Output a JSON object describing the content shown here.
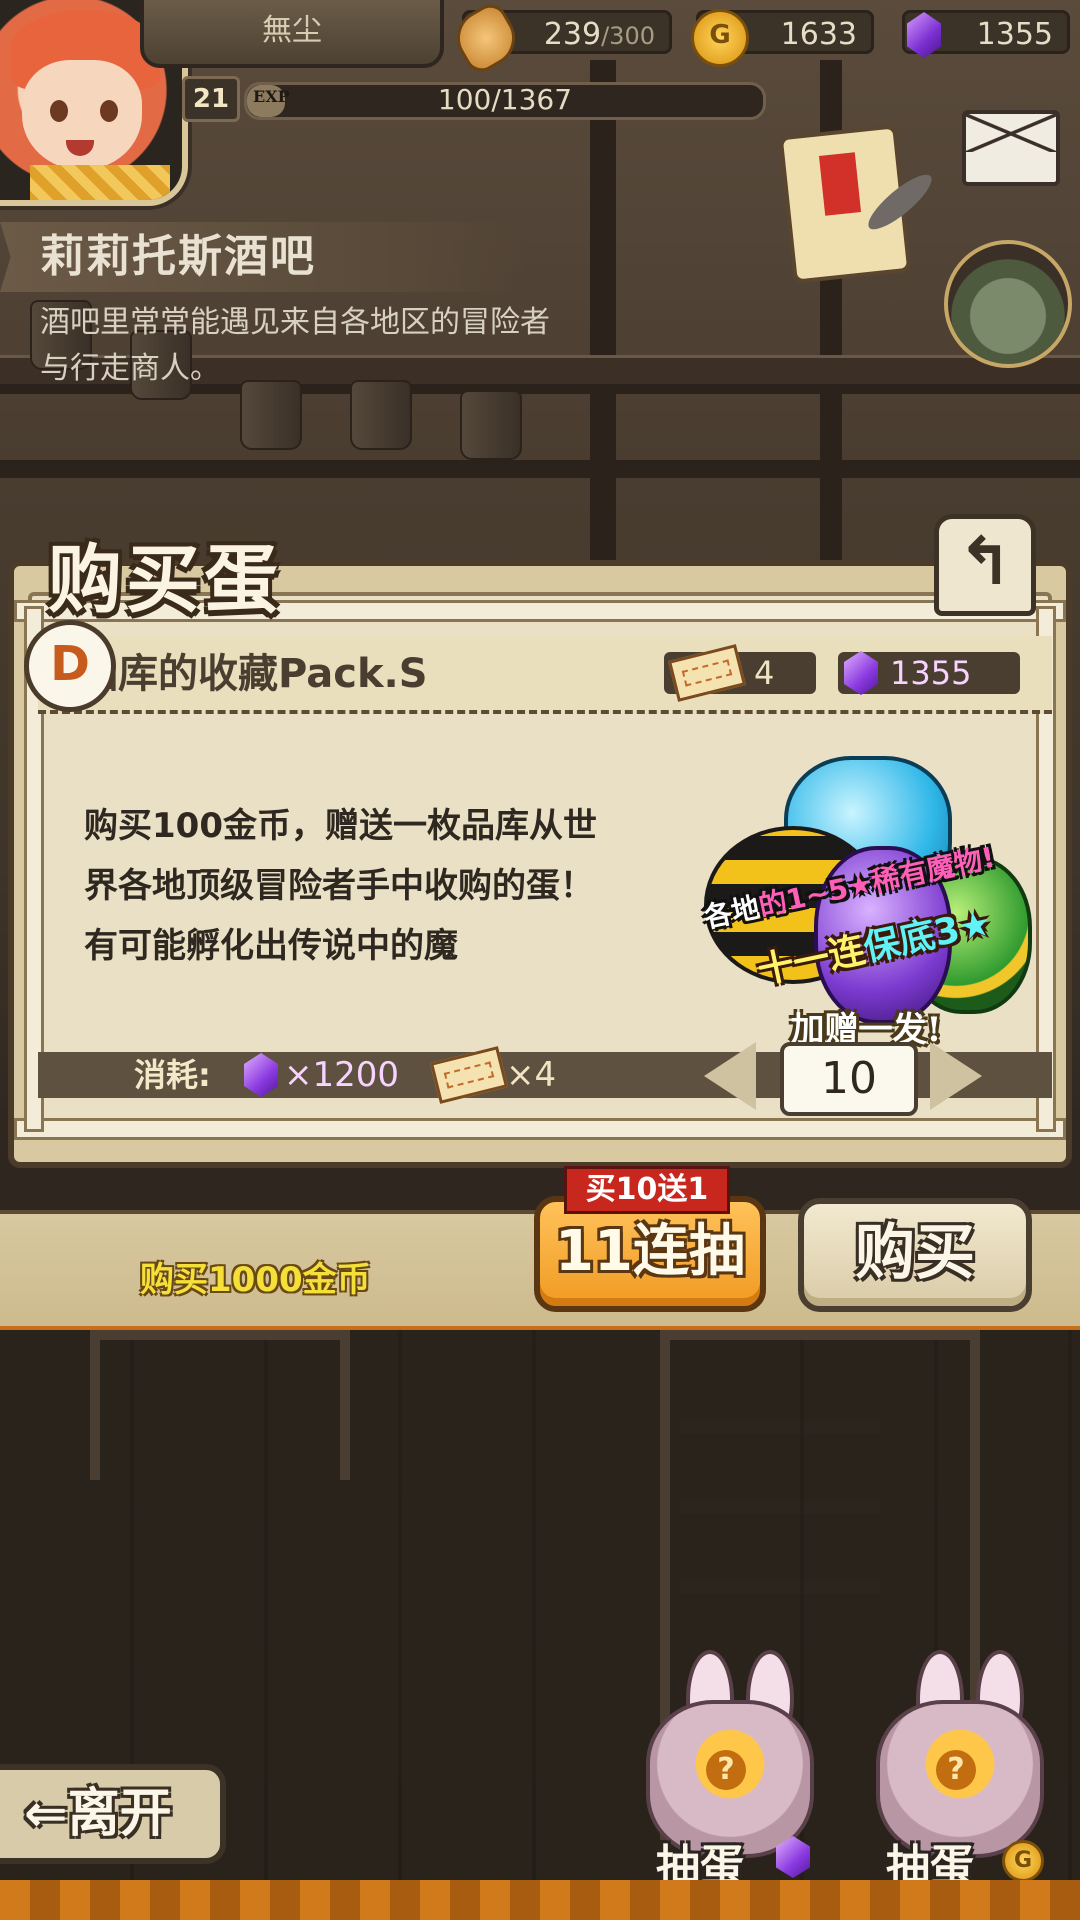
{
  "hud": {
    "player_name": "無尘",
    "level": "21",
    "exp_tag": "EXP",
    "exp_text": "100/1367",
    "exp_fraction": 0.073,
    "stamina_value": "239",
    "stamina_max": "/300",
    "gold": "1633",
    "gems": "1355",
    "coin_glyph": "G"
  },
  "location": {
    "title": "莉莉托斯酒吧",
    "description": "酒吧里常常能遇见来自各地区的冒险者与行走商人。"
  },
  "dialog": {
    "title": "购买蛋",
    "back_glyph": "↰",
    "pack_icon_glyph": "D",
    "pack_name": "品库的收藏Pack.S",
    "ticket_count": "4",
    "gem_count": "1355",
    "description": "购买100金币，赠送一枚品库从世界各地顶级冒险者手中收购的蛋！有可能孵化出传说中的魔",
    "promo": {
      "line1_a": "各地",
      "line1_b": "的1~5★稀有魔物!",
      "line2_a": "十一连",
      "line2_b": "保底3★",
      "bonus": "加赠一发!"
    },
    "cost_label": "消耗:",
    "cost_gems": "×1200",
    "cost_tickets": "×4",
    "quantity": "10"
  },
  "actions": {
    "gold_text": "购买1000金币",
    "promo_tag": "买10送1",
    "draw11_label": "11连抽",
    "buy_label": "购买"
  },
  "footer": {
    "leave_label": "⇐离开",
    "gacha_gem_label": "抽蛋",
    "gacha_gold_label": "抽蛋",
    "egg_mark": "?"
  }
}
